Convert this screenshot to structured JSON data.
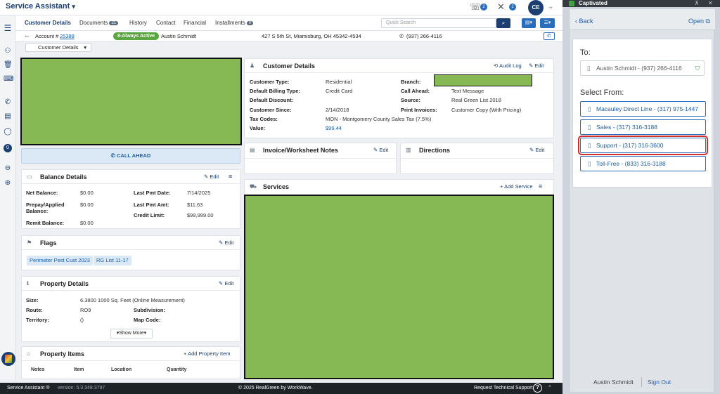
{
  "app": {
    "title": "Service Assistant"
  },
  "topbar": {
    "phone_badge": "2",
    "tools_badge": "2",
    "avatar": "CE"
  },
  "nav": {
    "tabs": [
      {
        "label": "Customer Details"
      },
      {
        "label": "Documents",
        "badge": "21"
      },
      {
        "label": "History"
      },
      {
        "label": "Contact"
      },
      {
        "label": "Financial"
      },
      {
        "label": "Installments",
        "badge": "0"
      }
    ],
    "search_placeholder": "Quick Search"
  },
  "account": {
    "label": "Account #",
    "number": "25388",
    "status": "8-Always Active",
    "name": "Austin Schmidt",
    "address": "427 S 5th St, Miamisburg, OH 45342-4534",
    "phone": "(937) 266-4116"
  },
  "view_dropdown": "Customer Details",
  "sidebar": {
    "badge": "0"
  },
  "call_ahead": "CALL AHEAD",
  "balance": {
    "title": "Balance Details",
    "edit": "Edit",
    "rows": [
      {
        "label": "Net Balance:",
        "value": "$0.00"
      },
      {
        "label": "Prepay/Applied Balance:",
        "value": "$0.00"
      },
      {
        "label": "Remit Balance:",
        "value": "$0.00"
      }
    ],
    "rows_right": [
      {
        "label": "Last Pmt Date:",
        "value": "7/14/2025"
      },
      {
        "label": "Last Pmt Amt:",
        "value": "$11.63"
      },
      {
        "label": "Credit Limit:",
        "value": "$99,999.00"
      }
    ]
  },
  "flags": {
    "title": "Flags",
    "edit": "Edit",
    "tags": [
      "Perimeter Pest Cust 2023",
      "RG List 11-17"
    ]
  },
  "property": {
    "title": "Property Details",
    "edit": "Edit",
    "size_label": "Size:",
    "size_value": "6.3800 1000 Sq. Feet (Online Measurement)",
    "route_label": "Route:",
    "route_value": "RO9",
    "subdivision_label": "Subdivision:",
    "territory_label": "Territory:",
    "territory_value": "()",
    "mapcode_label": "Map Code:",
    "show_more": "Show More"
  },
  "property_items": {
    "title": "Property Items",
    "add": "Add Property Item",
    "columns": [
      "Notes",
      "Item",
      "Location",
      "Quantity"
    ]
  },
  "customer_details": {
    "title": "Customer Details",
    "audit": "Audit Log",
    "edit": "Edit",
    "left": [
      {
        "label": "Customer Type:",
        "value": "Residential"
      },
      {
        "label": "Default Billing Type:",
        "value": "Credit Card"
      },
      {
        "label": "Default Discount:",
        "value": ""
      },
      {
        "label": "Customer Since:",
        "value": "2/14/2018"
      },
      {
        "label": "Tax Codes:",
        "value": "MON - Montgomery County Sales Tax  (7.5%)"
      },
      {
        "label": "Value:",
        "value": "$99.44"
      }
    ],
    "right": [
      {
        "label": "Branch:",
        "value": ""
      },
      {
        "label": "Call Ahead:",
        "value": "Text Message"
      },
      {
        "label": "Source:",
        "value": "Real Green List 2018"
      },
      {
        "label": "Print Invoices:",
        "value": "Customer Copy (With Pricing)"
      }
    ]
  },
  "invoice_notes": {
    "title": "Invoice/Worksheet Notes",
    "edit": "Edit"
  },
  "directions": {
    "title": "Directions",
    "edit": "Edit"
  },
  "services": {
    "title": "Services",
    "add": "Add Service"
  },
  "footer": {
    "app": "Service Assistant ®",
    "version": "version: 5.3.348.3797",
    "copyright": "© 2025 RealGreen by WorkWave.",
    "support": "Request Technical Support"
  },
  "captivated": {
    "title": "Captivated",
    "back": "Back",
    "open": "Open",
    "to_label": "To:",
    "to_value": "Austin Schmidt - (937) 266-4116",
    "select_label": "Select From:",
    "options": [
      "Macauley Direct Line - (317) 975-1447",
      "Sales - (317) 316-3188",
      "Support - (317) 316-3600",
      "Toll-Free - (833) 316-3188"
    ],
    "highlighted_index": 2,
    "user": "Austin Schmidt",
    "sign_out": "Sign Out"
  }
}
